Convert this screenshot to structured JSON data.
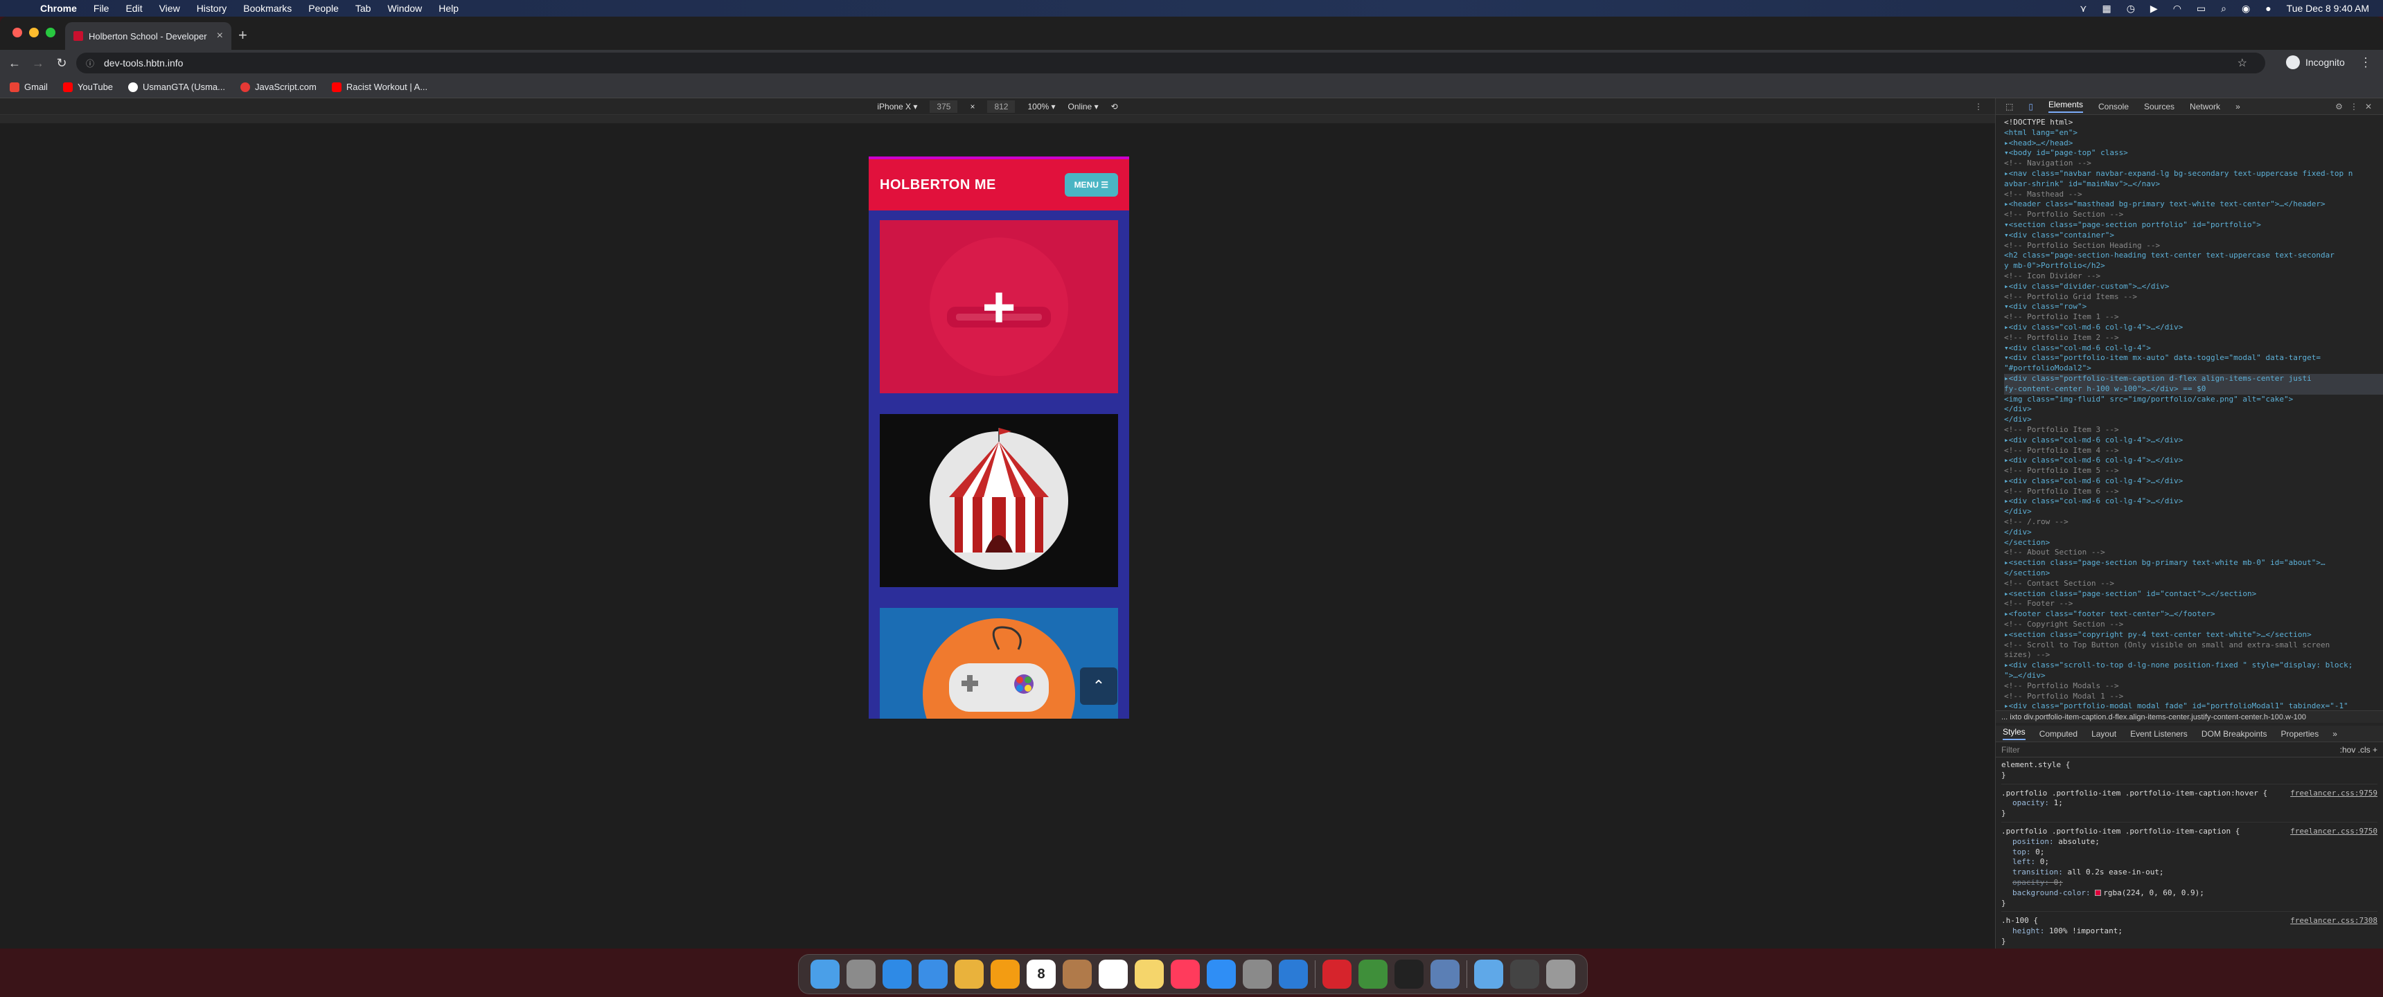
{
  "menubar": {
    "app": "Chrome",
    "items": [
      "File",
      "Edit",
      "View",
      "History",
      "Bookmarks",
      "People",
      "Tab",
      "Window",
      "Help"
    ],
    "clock": "Tue Dec 8  9:40 AM"
  },
  "browser": {
    "tab_title": "Holberton School - Developer",
    "url": "dev-tools.hbtn.info",
    "profile": "Incognito",
    "bookmarks": [
      {
        "label": "Gmail",
        "color": "#ea4335"
      },
      {
        "label": "YouTube",
        "color": "#ff0000"
      },
      {
        "label": "UsmanGTA (Usma...",
        "color": "#ffffff"
      },
      {
        "label": "JavaScript.com",
        "color": "#e53935"
      },
      {
        "label": "Racist Workout | A...",
        "color": "#ff0000"
      }
    ]
  },
  "device_toolbar": {
    "device": "iPhone X",
    "width": "375",
    "height": "812",
    "zoom": "100%",
    "network": "Online"
  },
  "site": {
    "brand": "HOLBERTON ME",
    "menu_label": "MENU ☰",
    "scroll_top_icon": "chevron-up-icon",
    "colors": {
      "nav": "#e1113c",
      "menu_btn": "#4ab5c4",
      "page_bg": "#2c2e9a"
    }
  },
  "devtools": {
    "tabs": [
      "Elements",
      "Console",
      "Sources",
      "Network",
      "»"
    ],
    "active_tab": "Elements",
    "dom_lines": [
      {
        "t": "<!DOCTYPE html>",
        "k": "txt"
      },
      {
        "t": "<html lang=\"en\">",
        "k": "tag"
      },
      {
        "t": "▸<head>…</head>",
        "k": "tag"
      },
      {
        "t": "▾<body id=\"page-top\" class>",
        "k": "tag"
      },
      {
        "t": "  <!-- Navigation -->",
        "k": "cmt"
      },
      {
        "t": "  ▸<nav class=\"navbar navbar-expand-lg bg-secondary text-uppercase fixed-top n",
        "k": "tag"
      },
      {
        "t": "   avbar-shrink\" id=\"mainNav\">…</nav>",
        "k": "tag"
      },
      {
        "t": "  <!-- Masthead -->",
        "k": "cmt"
      },
      {
        "t": "  ▸<header class=\"masthead bg-primary text-white text-center\">…</header>",
        "k": "tag"
      },
      {
        "t": "  <!-- Portfolio Section -->",
        "k": "cmt"
      },
      {
        "t": "  ▾<section class=\"page-section portfolio\" id=\"portfolio\">",
        "k": "tag"
      },
      {
        "t": "    ▾<div class=\"container\">",
        "k": "tag"
      },
      {
        "t": "       <!-- Portfolio Section Heading -->",
        "k": "cmt"
      },
      {
        "t": "       <h2 class=\"page-section-heading text-center text-uppercase text-secondar",
        "k": "tag"
      },
      {
        "t": "       y mb-0\">Portfolio</h2>",
        "k": "tag"
      },
      {
        "t": "       <!-- Icon Divider -->",
        "k": "cmt"
      },
      {
        "t": "      ▸<div class=\"divider-custom\">…</div>",
        "k": "tag"
      },
      {
        "t": "       <!-- Portfolio Grid Items -->",
        "k": "cmt"
      },
      {
        "t": "      ▾<div class=\"row\">",
        "k": "tag"
      },
      {
        "t": "         <!-- Portfolio Item 1 -->",
        "k": "cmt"
      },
      {
        "t": "        ▸<div class=\"col-md-6 col-lg-4\">…</div>",
        "k": "tag"
      },
      {
        "t": "         <!-- Portfolio Item 2 -->",
        "k": "cmt"
      },
      {
        "t": "        ▾<div class=\"col-md-6 col-lg-4\">",
        "k": "tag"
      },
      {
        "t": "          ▾<div class=\"portfolio-item mx-auto\" data-toggle=\"modal\" data-target=",
        "k": "tag"
      },
      {
        "t": "           \"#portfolioModal2\">",
        "k": "tag"
      },
      {
        "t": "            ▸<div class=\"portfolio-item-caption d-flex align-items-center justi",
        "k": "sel"
      },
      {
        "t": "             fy-content-center h-100 w-100\">…</div> == $0",
        "k": "sel"
      },
      {
        "t": "             <img class=\"img-fluid\" src=\"img/portfolio/cake.png\" alt=\"cake\">",
        "k": "tag"
      },
      {
        "t": "           </div>",
        "k": "tag"
      },
      {
        "t": "         </div>",
        "k": "tag"
      },
      {
        "t": "         <!-- Portfolio Item 3 -->",
        "k": "cmt"
      },
      {
        "t": "        ▸<div class=\"col-md-6 col-lg-4\">…</div>",
        "k": "tag"
      },
      {
        "t": "         <!-- Portfolio Item 4 -->",
        "k": "cmt"
      },
      {
        "t": "        ▸<div class=\"col-md-6 col-lg-4\">…</div>",
        "k": "tag"
      },
      {
        "t": "         <!-- Portfolio Item 5 -->",
        "k": "cmt"
      },
      {
        "t": "        ▸<div class=\"col-md-6 col-lg-4\">…</div>",
        "k": "tag"
      },
      {
        "t": "         <!-- Portfolio Item 6 -->",
        "k": "cmt"
      },
      {
        "t": "        ▸<div class=\"col-md-6 col-lg-4\">…</div>",
        "k": "tag"
      },
      {
        "t": "       </div>",
        "k": "tag"
      },
      {
        "t": "       <!-- /.row -->",
        "k": "cmt"
      },
      {
        "t": "     </div>",
        "k": "tag"
      },
      {
        "t": "   </section>",
        "k": "tag"
      },
      {
        "t": "   <!-- About Section -->",
        "k": "cmt"
      },
      {
        "t": "  ▸<section class=\"page-section bg-primary text-white mb-0\" id=\"about\">…",
        "k": "tag"
      },
      {
        "t": "   </section>",
        "k": "tag"
      },
      {
        "t": "   <!-- Contact Section -->",
        "k": "cmt"
      },
      {
        "t": "  ▸<section class=\"page-section\" id=\"contact\">…</section>",
        "k": "tag"
      },
      {
        "t": "   <!-- Footer -->",
        "k": "cmt"
      },
      {
        "t": "  ▸<footer class=\"footer text-center\">…</footer>",
        "k": "tag"
      },
      {
        "t": "   <!-- Copyright Section -->",
        "k": "cmt"
      },
      {
        "t": "  ▸<section class=\"copyright py-4 text-center text-white\">…</section>",
        "k": "tag"
      },
      {
        "t": "   <!-- Scroll to Top Button (Only visible on small and extra-small screen",
        "k": "cmt"
      },
      {
        "t": "   sizes) -->",
        "k": "cmt"
      },
      {
        "t": "  ▸<div class=\"scroll-to-top d-lg-none position-fixed \" style=\"display: block;",
        "k": "tag"
      },
      {
        "t": "   \">…</div>",
        "k": "tag"
      },
      {
        "t": "   <!-- Portfolio Modals -->",
        "k": "cmt"
      },
      {
        "t": "   <!-- Portfolio Modal 1 -->",
        "k": "cmt"
      },
      {
        "t": "  ▸<div class=\"portfolio-modal modal fade\" id=\"portfolioModal1\" tabindex=\"-1\"",
        "k": "tag"
      }
    ],
    "breadcrumb": "...  ixto   div.portfolio-item-caption.d-flex.align-items-center.justify-content-center.h-100.w-100",
    "styles_tabs": [
      "Styles",
      "Computed",
      "Layout",
      "Event Listeners",
      "DOM Breakpoints",
      "Properties",
      "»"
    ],
    "filter_placeholder": "Filter",
    "filter_right": ":hov  .cls  +",
    "rules": [
      {
        "selector": "element.style {",
        "source": "",
        "props": []
      },
      {
        "selector": ".portfolio .portfolio-item .portfolio-item-caption:hover {",
        "source": "freelancer.css:9759",
        "props": [
          {
            "n": "opacity",
            "v": "1;",
            "s": false
          }
        ]
      },
      {
        "selector": ".portfolio .portfolio-item .portfolio-item-caption {",
        "source": "freelancer.css:9750",
        "props": [
          {
            "n": "position",
            "v": "absolute;",
            "s": false
          },
          {
            "n": "top",
            "v": "0;",
            "s": false
          },
          {
            "n": "left",
            "v": "0;",
            "s": false
          },
          {
            "n": "transition",
            "v": "all 0.2s ease-in-out;",
            "s": false
          },
          {
            "n": "opacity",
            "v": "0;",
            "s": true
          },
          {
            "n": "background-color",
            "v": "rgba(224, 0, 60, 0.9);",
            "s": false,
            "swatch": "#e0003c"
          }
        ]
      },
      {
        "selector": ".h-100 {",
        "source": "freelancer.css:7308",
        "props": [
          {
            "n": "height",
            "v": "100% !important;",
            "s": false
          }
        ]
      }
    ]
  },
  "dock": {
    "icons": [
      "finder-icon",
      "launchpad-icon",
      "safari-icon",
      "mail-icon",
      "slack-icon",
      "photos-icon",
      "calendar-icon",
      "contacts-icon",
      "reminders-icon",
      "notes-icon",
      "news-icon",
      "app-store-icon",
      "system-preferences-icon",
      "vscode-icon",
      "expressvpn-icon",
      "chrome-icon",
      "terminal-icon",
      "preview-icon",
      "folder-icon",
      "downloads-icon",
      "trash-icon"
    ],
    "colors": [
      "#4a9fe8",
      "#8b8b8b",
      "#2e8ae6",
      "#3a8ee6",
      "#e9b23c",
      "#f39c12",
      "#ffffff",
      "#b07a4a",
      "#ffffff",
      "#f5d56b",
      "#ff3b5c",
      "#2f8ef5",
      "#8a8a8a",
      "#2b7bd6",
      "#d6242c",
      "#3f8f3a",
      "#222222",
      "#5b7fb5",
      "#5fa8e8",
      "#444444",
      "#999999"
    ],
    "calendar_day": "8"
  }
}
